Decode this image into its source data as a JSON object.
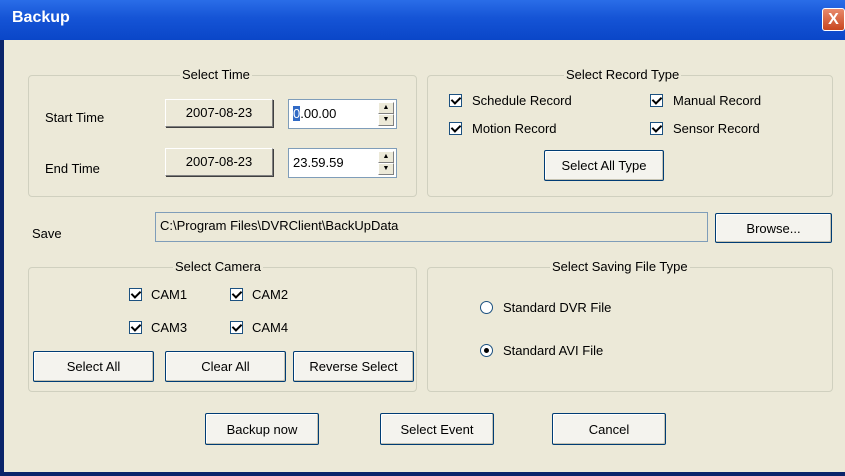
{
  "window": {
    "title": "Backup",
    "close_glyph": "X"
  },
  "select_time": {
    "legend": "Select Time",
    "start_label": "Start Time",
    "start_date": "2007-08-23",
    "start_time_first": "0",
    "start_time_rest": ".00.00",
    "end_label": "End Time",
    "end_date": "2007-08-23",
    "end_time": "23.59.59"
  },
  "record_type": {
    "legend": "Select Record Type",
    "schedule": "Schedule Record",
    "manual": "Manual Record",
    "motion": "Motion Record",
    "sensor": "Sensor Record",
    "select_all_type": "Select All Type"
  },
  "save": {
    "label": "Save",
    "path": "C:\\Program Files\\DVRClient\\BackUpData",
    "browse": "Browse..."
  },
  "camera": {
    "legend": "Select Camera",
    "cam1": "CAM1",
    "cam2": "CAM2",
    "cam3": "CAM3",
    "cam4": "CAM4",
    "select_all": "Select All",
    "clear_all": "Clear All",
    "reverse_select": "Reverse Select"
  },
  "file_type": {
    "legend": "Select Saving File Type",
    "dvr": "Standard DVR File",
    "avi": "Standard AVI File",
    "selected": "avi"
  },
  "actions": {
    "backup_now": "Backup now",
    "select_event": "Select Event",
    "cancel": "Cancel"
  }
}
